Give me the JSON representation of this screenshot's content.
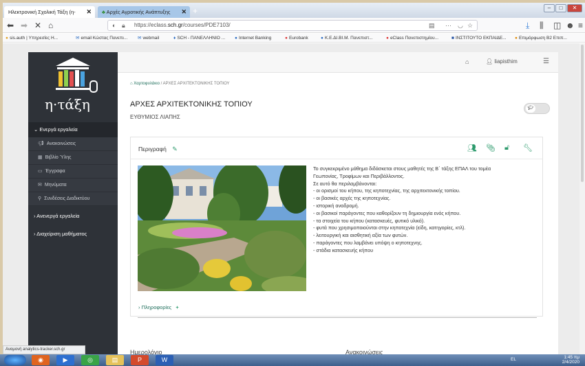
{
  "browser": {
    "tabs": [
      {
        "label": "Ηλεκτρονική Σχολική Τάξη (η-",
        "active": true
      },
      {
        "label": "Αρχές Αγροτικής Ανάπτυξης",
        "active": false
      }
    ],
    "url_prefix": "https://eclass.",
    "url_domain": "sch.gr",
    "url_path": "/courses/PDE7103/",
    "bookmarks": [
      "sis.auth | Υπηρεσίες Η...",
      "email Κώστας Πανεπι...",
      "webmail",
      "SCH - ΠΑΝΕΛΛΗΝΙΟ ...",
      "Internet Banking",
      "Eurobank",
      "Κ.Ε.ΔΙ.ΒΙ.Μ. Πανεπιστ...",
      "eClass Πανεπιστημίου...",
      "ΙΝΣΤΙΤΟΥΤΟ ΕΚΠΑΙΔΕ...",
      "Επιμόρφωση Β2 Επιπ..."
    ]
  },
  "site": {
    "logo_text": "η·τάξη",
    "user": "liapisthim"
  },
  "sidebar": {
    "active_group": "Ενεργά εργαλεία",
    "items": [
      {
        "label": "Ανακοινώσεις",
        "icon": "megaphone-icon"
      },
      {
        "label": "Βιβλίο Ύλης",
        "icon": "calendar-icon"
      },
      {
        "label": "Έγγραφα",
        "icon": "folder-icon"
      },
      {
        "label": "Μηνύματα",
        "icon": "envelope-icon"
      },
      {
        "label": "Συνδέσεις Διαδικτύου",
        "icon": "link-icon"
      }
    ],
    "groups": [
      "Ανενεργά εργαλεία",
      "Διαχείριση μαθήματος"
    ]
  },
  "course": {
    "breadcrumb_home": "Χαρτοφυλάκιο",
    "breadcrumb_current": "ΑΡΧΕΣ ΑΡΧΙΤΕΚΤΟΝΙΚΗΣ ΤΟΠΙΟΥ",
    "title": "ΑΡΧΕΣ ΑΡΧΙΤΕΚΤΟΝΙΚΗΣ ΤΟΠΙΟΥ",
    "owner": "ΕΥΘΥΜΙΟΣ ΛΙΑΠΗΣ"
  },
  "description": {
    "heading": "Περιγραφή",
    "lines": [
      "Το συγκεκριμένο μάθημα διδάσκεται στους μαθητές της Β΄ τάξης ΕΠΑΛ του τομέα",
      "Γεωπονίας, Τροφίμων και Περιβάλλοντος.",
      "Σε αυτό θα περιλαμβάνονται:",
      "- οι ορισμοί του κήπου, της κηποτεχνίας, της αρχιτεκτονικής τοπίου.",
      "- οι βασικές αρχές της κηποτεχνίας.",
      "- ιστορική αναδρομή.",
      "- οι βασικοί παράγοντες που καθορίζουν τη δημιουργία ενός κήπου.",
      "- τα στοιχεία του κήπου (κατασκευές, φυτικό υλικό).",
      "- φυτά που χρησιμοποιούνται στην κηποτεχνία (είδη, κατηγορίες, κτλ).",
      "- λειτουργική και αισθητική αξία των φυτών.",
      "- παράγοντες που λαμβάνει υπόψη ο κηποτεχνης.",
      "- στάδια κατασκευής κήπου"
    ],
    "info_label": "Πληροφορίες"
  },
  "lower": {
    "calendar": "Ημερολόγιο",
    "announcements": "Ανακοινώσεις"
  },
  "status_text": "Αναμονή analytics-tracker.sch.gr",
  "taskbar": {
    "lang": "EL",
    "time": "1:45 πμ",
    "date": "2/4/2020"
  }
}
